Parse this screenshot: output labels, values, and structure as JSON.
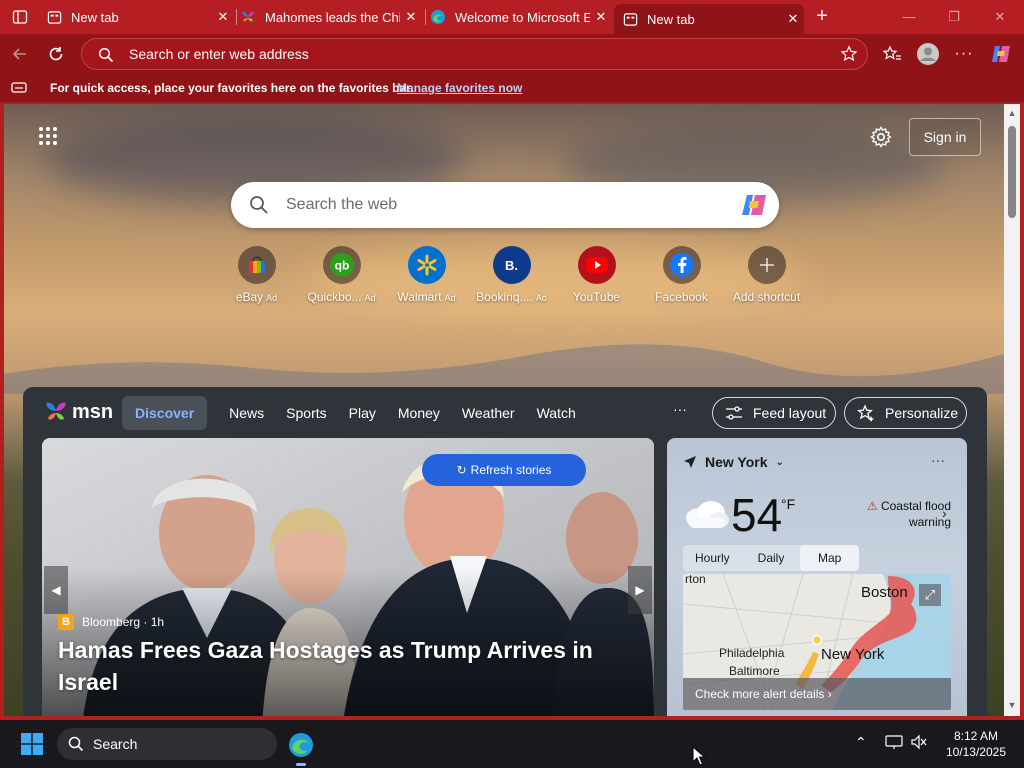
{
  "tabs": [
    {
      "title": "New tab",
      "active": false,
      "favicon": "newtab-icon"
    },
    {
      "title": "Mahomes leads the Chi",
      "active": false,
      "favicon": "msn-butterfly-icon"
    },
    {
      "title": "Welcome to Microsoft E",
      "active": false,
      "favicon": "edge-icon"
    },
    {
      "title": "New tab",
      "active": true,
      "favicon": "newtab-icon"
    }
  ],
  "address_bar": {
    "placeholder": "Search or enter web address"
  },
  "favorites_bar": {
    "message": "For quick access, place your favorites here on the favorites bar.",
    "link": "Manage favorites now"
  },
  "page": {
    "sign_in": "Sign in",
    "search_placeholder": "Search the web",
    "shortcuts": [
      {
        "label": "eBay",
        "ad": "Ad",
        "icon": "ebay-icon"
      },
      {
        "label": "Quickbo...",
        "ad": "Ad",
        "icon": "quickbooks-icon"
      },
      {
        "label": "Walmart",
        "ad": "Ad",
        "icon": "walmart-icon"
      },
      {
        "label": "Bookinq....",
        "ad": "Ad",
        "icon": "booking-icon"
      },
      {
        "label": "YouTube",
        "ad": "",
        "icon": "youtube-icon"
      },
      {
        "label": "Facebook",
        "ad": "",
        "icon": "facebook-icon"
      },
      {
        "label": "Add shortcut",
        "ad": "",
        "icon": "plus-icon"
      }
    ]
  },
  "feed": {
    "brand": "msn",
    "nav": [
      "Discover",
      "News",
      "Sports",
      "Play",
      "Money",
      "Weather",
      "Watch"
    ],
    "active_nav": "Discover",
    "more": "···",
    "feed_layout": "Feed layout",
    "personalize": "Personalize",
    "hero": {
      "refresh": "Refresh stories",
      "source": "Bloomberg · 1h",
      "headline": "Hamas Frees Gaza Hostages as Trump Arrives in Israel"
    },
    "weather": {
      "location": "New York",
      "temp": "54",
      "unit": "°F",
      "alert": "Coastal flood warning",
      "tabs": [
        "Hourly",
        "Daily",
        "Map"
      ],
      "active_tab": "Map",
      "map_labels": [
        "Boston",
        "Philadelphia",
        "Baltimore",
        "New York"
      ],
      "map_city_small": "rton",
      "alert_details": "Check more alert details"
    }
  },
  "taskbar": {
    "search": "Search",
    "time": "8:12 AM",
    "date": "10/13/2025"
  },
  "colors": {
    "theme": "#b51e22",
    "theme_dark": "#8f1317",
    "accent": "#2563dc",
    "msn_active": "#8ab4ff"
  }
}
